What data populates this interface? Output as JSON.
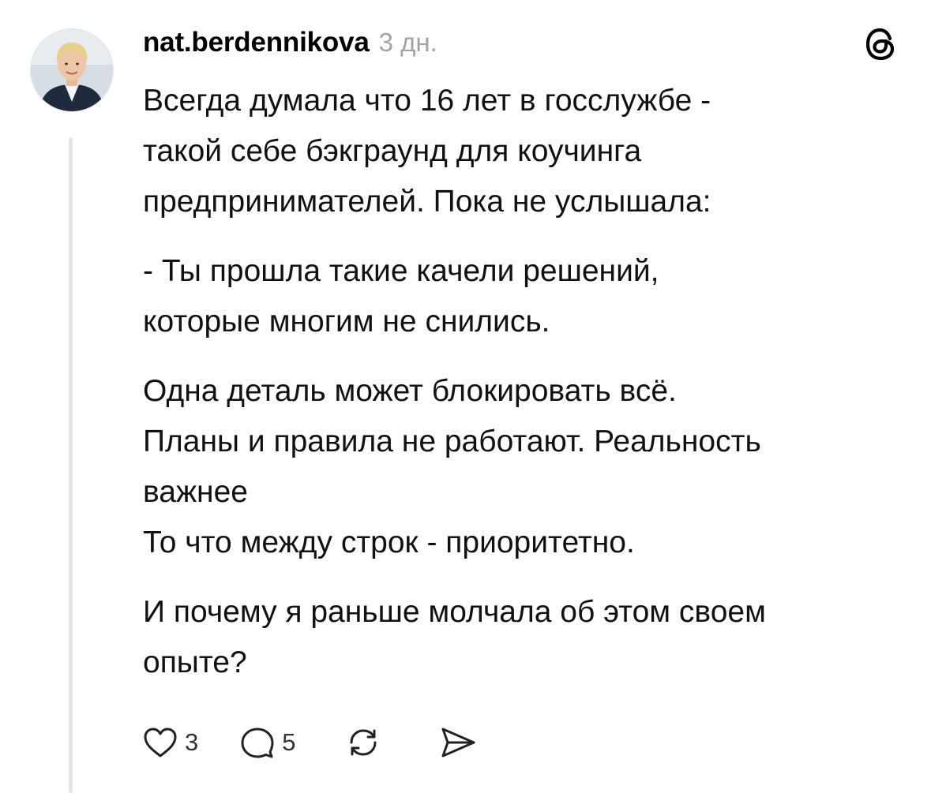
{
  "post": {
    "username": "nat.berdennikova",
    "timestamp": "3 дн.",
    "paragraphs": [
      [
        "Всегда думала что 16 лет в госслужбе -",
        "такой себе бэкграунд для коучинга",
        "предпринимателей. Пока не услышала:"
      ],
      [
        "- Ты прошла такие качели решений,",
        "которые многим не снились."
      ],
      [
        "Одна деталь может блокировать всё.",
        "Планы и правила не работают. Реальность",
        "важнее",
        "То что между строк - приоритетно."
      ],
      [
        "И почему я раньше молчала об этом своем",
        "опыте?"
      ]
    ]
  },
  "actions": {
    "like": {
      "icon": "heart-icon",
      "count": "3"
    },
    "reply": {
      "icon": "comment-icon",
      "count": "5"
    },
    "repost": {
      "icon": "repost-icon"
    },
    "share": {
      "icon": "send-icon"
    }
  },
  "brand": {
    "logo": "threads-logo-icon"
  },
  "colors": {
    "text": "#111111",
    "muted": "#a3a3a3",
    "thread_line": "#e5e5e5"
  }
}
